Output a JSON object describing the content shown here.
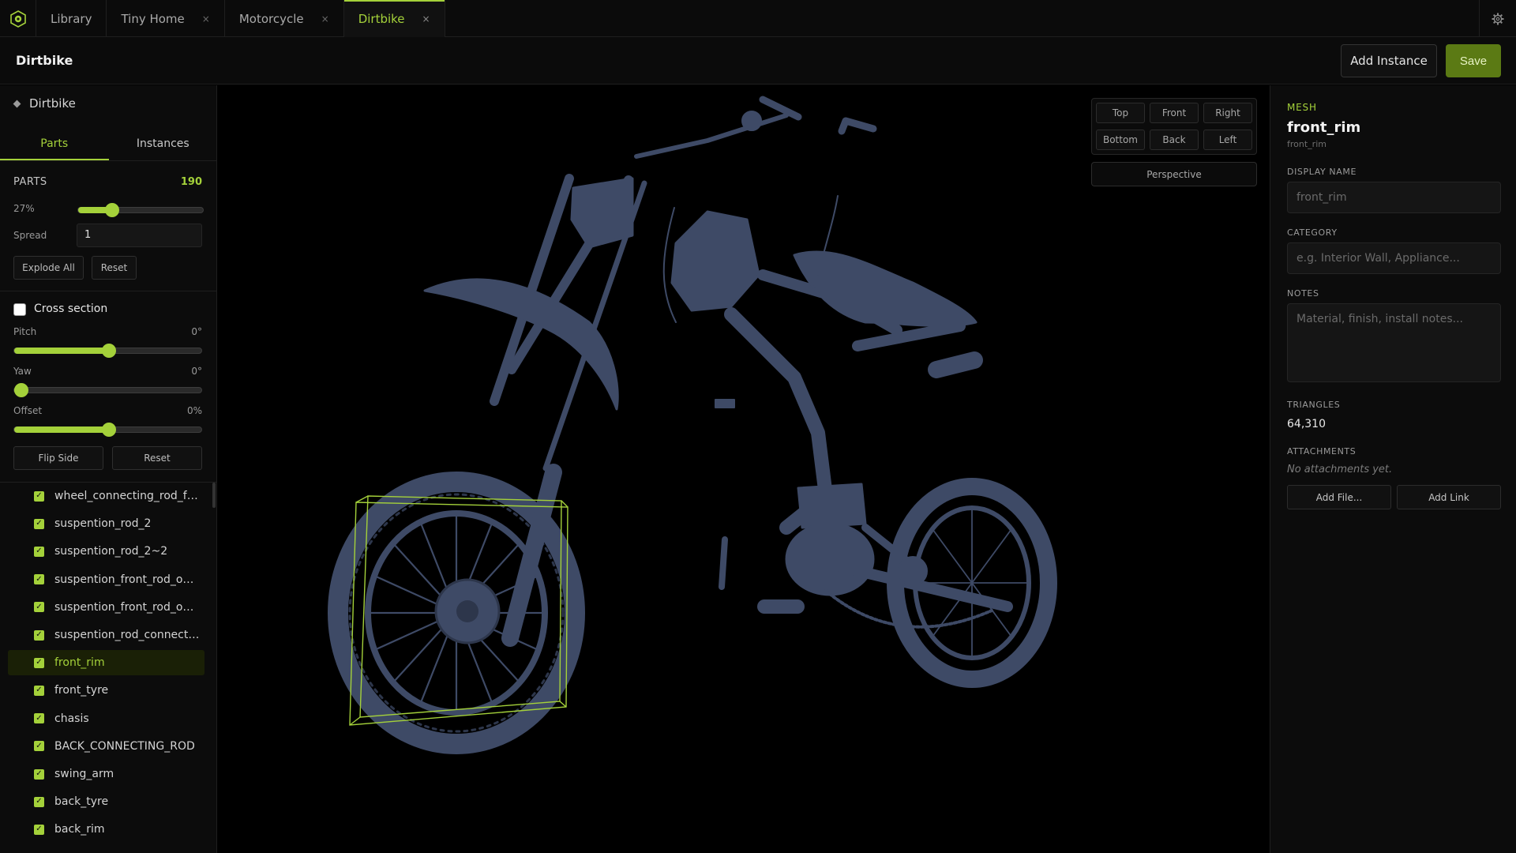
{
  "tabs": [
    {
      "label": "Library",
      "closable": false,
      "active": false
    },
    {
      "label": "Tiny Home",
      "closable": true,
      "active": false
    },
    {
      "label": "Motorcycle",
      "closable": true,
      "active": false
    },
    {
      "label": "Dirtbike",
      "closable": true,
      "active": true
    }
  ],
  "tab_close_glyph": "×",
  "header": {
    "title": "Dirtbike",
    "add_instance_label": "Add Instance",
    "save_label": "Save"
  },
  "sidebar": {
    "root_label": "Dirtbike",
    "tabs": [
      "Parts",
      "Instances"
    ],
    "parts_header": "PARTS",
    "parts_count": "190",
    "explode_percent_label": "27%",
    "explode_value": 0.27,
    "spread_label": "Spread",
    "spread_value": "1",
    "explode_all_label": "Explode All",
    "reset_label": "Reset",
    "cross_section_label": "Cross section",
    "cross_section_checked": false,
    "pitch_label": "Pitch",
    "pitch_value": "0°",
    "pitch_fraction": 0.5,
    "yaw_label": "Yaw",
    "yaw_value": "0°",
    "yaw_fraction": 0.0,
    "offset_label": "Offset",
    "offset_value": "0%",
    "offset_fraction": 0.5,
    "flip_side_label": "Flip Side",
    "reset2_label": "Reset",
    "parts": [
      {
        "name": "wheel_connecting_rod_fro...",
        "checked": true,
        "selected": false
      },
      {
        "name": "suspention_rod_2",
        "checked": true,
        "selected": false
      },
      {
        "name": "suspention_rod_2~2",
        "checked": true,
        "selected": false
      },
      {
        "name": "suspention_front_rod_one...",
        "checked": true,
        "selected": false
      },
      {
        "name": "suspention_front_rod_one...",
        "checked": true,
        "selected": false
      },
      {
        "name": "suspention_rod_connector...",
        "checked": true,
        "selected": false
      },
      {
        "name": "front_rim",
        "checked": true,
        "selected": true
      },
      {
        "name": "front_tyre",
        "checked": true,
        "selected": false
      },
      {
        "name": "chasis",
        "checked": true,
        "selected": false
      },
      {
        "name": "BACK_CONNECTING_ROD",
        "checked": true,
        "selected": false
      },
      {
        "name": "swing_arm",
        "checked": true,
        "selected": false
      },
      {
        "name": "back_tyre",
        "checked": true,
        "selected": false
      },
      {
        "name": "back_rim",
        "checked": true,
        "selected": false
      }
    ]
  },
  "viewport": {
    "view_buttons": [
      "Top",
      "Front",
      "Right",
      "Bottom",
      "Back",
      "Left"
    ],
    "perspective_label": "Perspective"
  },
  "inspector": {
    "kind": "MESH",
    "name": "front_rim",
    "subname": "front_rim",
    "display_name_label": "DISPLAY NAME",
    "display_name_value": "front_rim",
    "category_label": "CATEGORY",
    "category_placeholder": "e.g. Interior Wall, Appliance...",
    "notes_label": "NOTES",
    "notes_placeholder": "Material, finish, install notes...",
    "triangles_label": "TRIANGLES",
    "triangles_value": "64,310",
    "attachments_label": "ATTACHMENTS",
    "attachments_empty": "No attachments yet.",
    "add_file_label": "Add File...",
    "add_link_label": "Add Link"
  },
  "colors": {
    "accent": "#a4d13a",
    "save_bg": "#5b7a14",
    "model": "#3e4a66",
    "background": "#000000"
  },
  "icons": {
    "logo": "app-logo-icon",
    "settings": "gear-icon",
    "root": "diamond-icon"
  }
}
